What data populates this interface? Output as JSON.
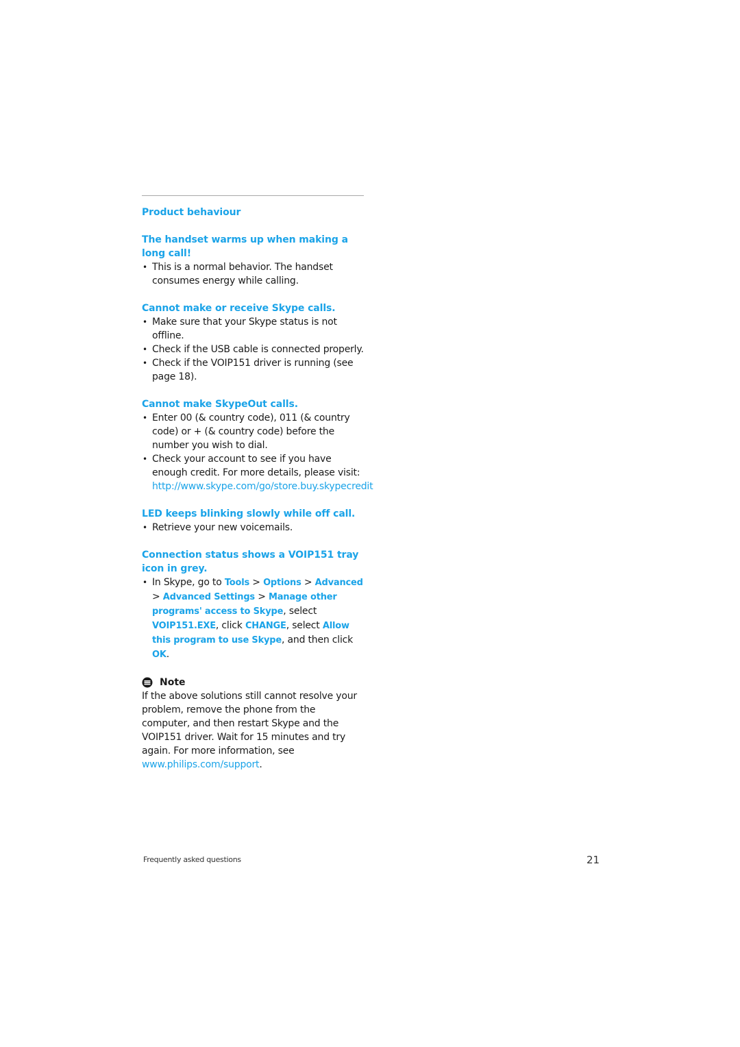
{
  "section_title": "Product behaviour",
  "sections": [
    {
      "heading": "The handset warms up when making a long call!",
      "items": [
        "This is a normal behavior. The handset consumes energy while calling."
      ]
    },
    {
      "heading": "Cannot make or receive Skype calls.",
      "items": [
        "Make sure that your Skype status is not offline.",
        "Check if the USB cable is connected properly.",
        "Check if the VOIP151 driver is running (see page 18)."
      ]
    },
    {
      "heading": "Cannot make SkypeOut calls.",
      "items": [
        "Enter 00 (& country code), 011 (& country code)  or +  (& country code) before the number you wish to dial.",
        "Check your account to see if you have enough credit. For more details, please visit:"
      ],
      "link": "http://www.skype.com/go/store.buy.skypecredit"
    },
    {
      "heading": "LED keeps blinking slowly while off call.",
      "items": [
        "Retrieve your new voicemails."
      ]
    },
    {
      "heading": "Connection status shows a VOIP151 tray icon in grey.",
      "steps": {
        "t1": "In Skype, go to ",
        "tools": "Tools",
        "sep1": " > ",
        "options": "Options",
        "sep2": " > ",
        "advanced": "Advanced",
        "sep3": " > ",
        "advanced_settings": "Advanced Settings",
        "sep4": " > ",
        "manage": "Manage other programs' access to Skype",
        "t2": ", select ",
        "exe": "VOIP151.EXE",
        "t3": ", click ",
        "change": "CHANGE",
        "t4": ", select ",
        "allow": "Allow this program to use Skype",
        "t5": ", and then click ",
        "ok": "OK",
        "t6": "."
      }
    }
  ],
  "note": {
    "icon": "note-icon",
    "title": "Note",
    "body": "If the above solutions still cannot resolve your problem, remove the phone from the computer, and then restart Skype and the VOIP151 driver. Wait for 15 minutes and try again. For more information, see ",
    "link": "www.philips.com/support",
    "end": "."
  },
  "footer": {
    "chapter": "Frequently asked questions",
    "page_number": "21"
  }
}
